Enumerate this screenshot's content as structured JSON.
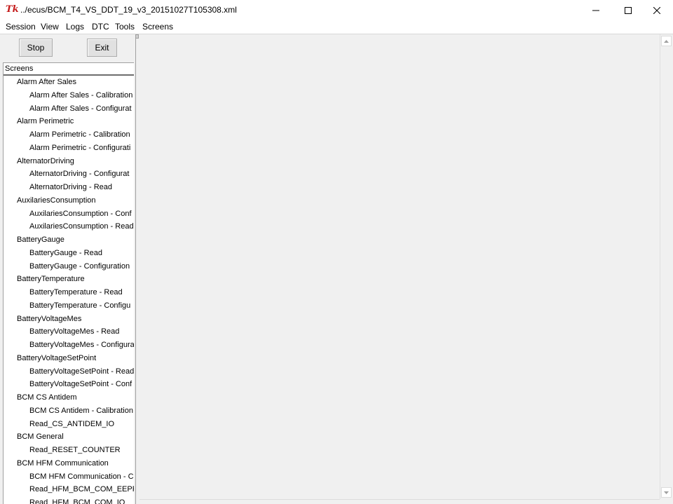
{
  "window": {
    "title": "../ecus/BCM_T4_VS_DDT_19_v3_20151027T105308.xml",
    "app_icon": "Tk",
    "controls": {
      "minimize": "minimize-icon",
      "maximize": "maximize-icon",
      "close": "close-icon"
    }
  },
  "menu": [
    "Session",
    "View",
    "Logs",
    "DTC",
    "Tools",
    "Screens"
  ],
  "toolbar": {
    "stop_label": "Stop",
    "exit_label": "Exit"
  },
  "tree": {
    "header": "Screens",
    "rows": [
      {
        "type": "group",
        "label": "Alarm After Sales"
      },
      {
        "type": "child",
        "label": "Alarm After Sales - Calibration"
      },
      {
        "type": "child",
        "label": "Alarm After Sales - Configurat"
      },
      {
        "type": "group",
        "label": "Alarm Perimetric"
      },
      {
        "type": "child",
        "label": "Alarm Perimetric - Calibration"
      },
      {
        "type": "child",
        "label": "Alarm Perimetric - Configurati"
      },
      {
        "type": "group",
        "label": "AlternatorDriving"
      },
      {
        "type": "child",
        "label": "AlternatorDriving - Configurat"
      },
      {
        "type": "child",
        "label": "AlternatorDriving - Read"
      },
      {
        "type": "group",
        "label": "AuxilariesConsumption"
      },
      {
        "type": "child",
        "label": "AuxilariesConsumption - Conf"
      },
      {
        "type": "child",
        "label": "AuxilariesConsumption - Read"
      },
      {
        "type": "group",
        "label": "BatteryGauge"
      },
      {
        "type": "child",
        "label": "BatteryGauge - Read"
      },
      {
        "type": "child",
        "label": "BatteryGauge - Configuration"
      },
      {
        "type": "group",
        "label": "BatteryTemperature"
      },
      {
        "type": "child",
        "label": "BatteryTemperature - Read"
      },
      {
        "type": "child",
        "label": "BatteryTemperature - Configu"
      },
      {
        "type": "group",
        "label": "BatteryVoltageMes"
      },
      {
        "type": "child",
        "label": "BatteryVoltageMes - Read"
      },
      {
        "type": "child",
        "label": "BatteryVoltageMes - Configura"
      },
      {
        "type": "group",
        "label": "BatteryVoltageSetPoint"
      },
      {
        "type": "child",
        "label": "BatteryVoltageSetPoint - Read"
      },
      {
        "type": "child",
        "label": "BatteryVoltageSetPoint - Conf"
      },
      {
        "type": "group",
        "label": "BCM CS Antidem"
      },
      {
        "type": "child",
        "label": "BCM CS Antidem - Calibration"
      },
      {
        "type": "child",
        "label": "Read_CS_ANTIDEM_IO"
      },
      {
        "type": "group",
        "label": "BCM General"
      },
      {
        "type": "child",
        "label": "Read_RESET_COUNTER"
      },
      {
        "type": "group",
        "label": "BCM HFM Communication"
      },
      {
        "type": "child",
        "label": "BCM HFM Communication - C"
      },
      {
        "type": "child",
        "label": "Read_HFM_BCM_COM_EEPRO"
      },
      {
        "type": "child",
        "label": "Read_HFM_BCM_COM_IO"
      }
    ]
  }
}
